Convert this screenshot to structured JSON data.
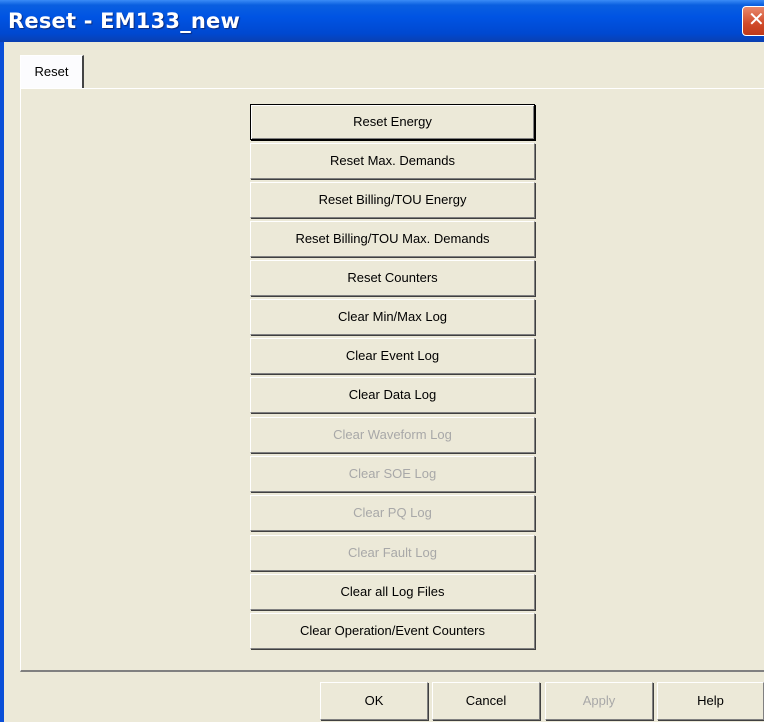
{
  "window": {
    "title": "Reset - EM133_new",
    "close_glyph": "✕"
  },
  "tabs": [
    {
      "label": "Reset",
      "selected": true
    }
  ],
  "actions": [
    {
      "label": "Reset Energy",
      "enabled": true,
      "focused": true
    },
    {
      "label": "Reset Max. Demands",
      "enabled": true
    },
    {
      "label": "Reset Billing/TOU Energy",
      "enabled": true
    },
    {
      "label": "Reset Billing/TOU Max. Demands",
      "enabled": true
    },
    {
      "label": "Reset Counters",
      "enabled": true
    },
    {
      "label": "Clear Min/Max Log",
      "enabled": true
    },
    {
      "label": "Clear Event Log",
      "enabled": true
    },
    {
      "label": "Clear Data Log",
      "enabled": true
    },
    {
      "label": "Clear Waveform Log",
      "enabled": false
    },
    {
      "label": "Clear SOE Log",
      "enabled": false
    },
    {
      "label": "Clear PQ Log",
      "enabled": false
    },
    {
      "label": "Clear Fault Log",
      "enabled": false
    },
    {
      "label": "Clear all Log Files",
      "enabled": true
    },
    {
      "label": "Clear Operation/Event Counters",
      "enabled": true
    }
  ],
  "footer": {
    "ok_label": "OK",
    "cancel_label": "Cancel",
    "apply_label": "Apply",
    "apply_enabled": false,
    "help_label": "Help"
  },
  "colors": {
    "titlebar": "#0054e3",
    "dialog_bg": "#ece9d8",
    "disabled_text": "#a8a8a8",
    "close_button": "#d04a2a"
  }
}
